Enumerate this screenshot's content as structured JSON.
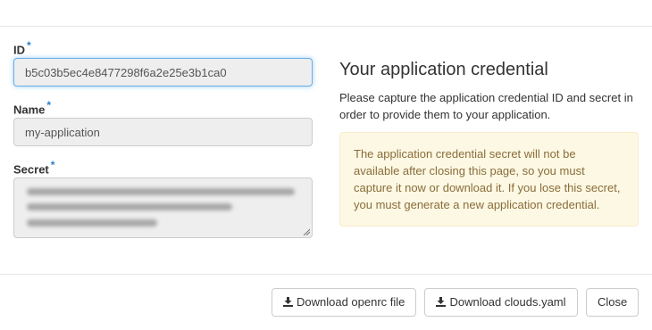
{
  "form": {
    "id": {
      "label": "ID",
      "required_mark": "*",
      "value": "b5c03b5ec4e8477298f6a2e25e3b1ca0"
    },
    "name": {
      "label": "Name",
      "required_mark": "*",
      "value": "my-application"
    },
    "secret": {
      "label": "Secret",
      "required_mark": "*"
    }
  },
  "info": {
    "heading": "Your application credential",
    "description": "Please capture the application credential ID and secret in order to provide them to your application.",
    "warning": "The application credential secret will not be available after closing this page, so you must capture it now or download it. If you lose this secret, you must generate a new application credential."
  },
  "footer": {
    "download_openrc_label": "Download openrc file",
    "download_clouds_label": "Download clouds.yaml",
    "close_label": "Close"
  },
  "colors": {
    "required_mark": "#2a7fc9",
    "warning_bg": "#fcf8e3",
    "warning_text": "#8a6d3b",
    "focus_border": "#66afe9"
  },
  "icons": {
    "download": "download-icon",
    "resize": "resize-grip-icon"
  }
}
